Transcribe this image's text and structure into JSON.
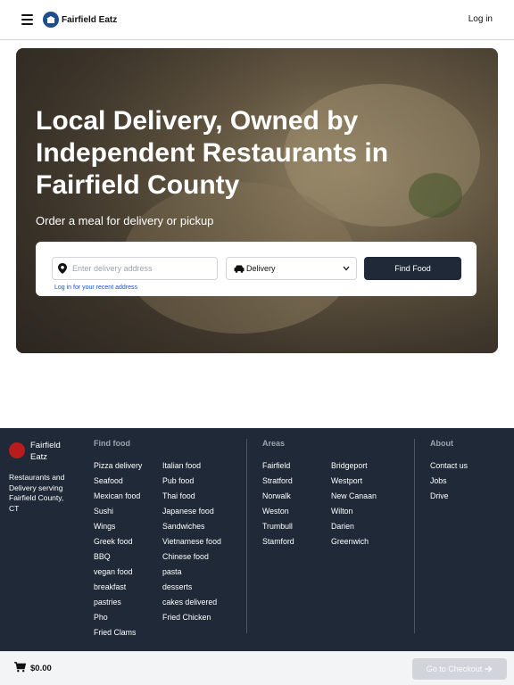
{
  "header": {
    "brand": "Fairfield Eatz",
    "login_label": "Log in"
  },
  "hero": {
    "title": "Local Delivery, Owned by Independent Restaurants in Fairfield County",
    "subtitle": "Order a meal for delivery or pickup",
    "address_placeholder": "Enter delivery address",
    "login_hint": "Log in for your recent address",
    "mode_selected": "Delivery",
    "find_label": "Find Food"
  },
  "footer": {
    "brand_name": "Fairfield Eatz",
    "tagline": "Restaurants and Delivery serving Fairfield County, CT",
    "find_food": {
      "heading": "Find food",
      "col1": [
        "Pizza delivery",
        "Seafood",
        "Mexican food",
        "Sushi",
        "Wings",
        "Greek food",
        "BBQ",
        "vegan food",
        "breakfast",
        "pastries",
        "Pho",
        "Fried Clams"
      ],
      "col2": [
        "Italian food",
        "Pub food",
        "Thai food",
        "Japanese food",
        "Sandwiches",
        "Vietnamese food",
        "Chinese food",
        "pasta",
        "desserts",
        "cakes delivered",
        "Fried Chicken"
      ]
    },
    "areas": {
      "heading": "Areas",
      "col1": [
        "Fairfield",
        "Stratford",
        "Norwalk",
        "Weston",
        "Trumbull",
        "Stamford"
      ],
      "col2": [
        "Bridgeport",
        "Westport",
        "New Canaan",
        "Wilton",
        "Darien",
        "Greenwich"
      ]
    },
    "about": {
      "heading": "About",
      "items": [
        "Contact us",
        "Jobs",
        "Drive"
      ]
    }
  },
  "cart": {
    "total": "$0.00",
    "checkout_label": "Go to Checkout"
  },
  "colors": {
    "footer_bg": "#1f2937",
    "button_dark": "#1f2937",
    "brand_blue": "#1f4e8c",
    "link_blue": "#1d4ed8",
    "disabled_button": "#d1d5db"
  },
  "icons": [
    "menu-icon",
    "logo-icon",
    "location-pin-icon",
    "car-icon",
    "chevron-down-icon",
    "cart-icon",
    "arrow-right-icon"
  ]
}
